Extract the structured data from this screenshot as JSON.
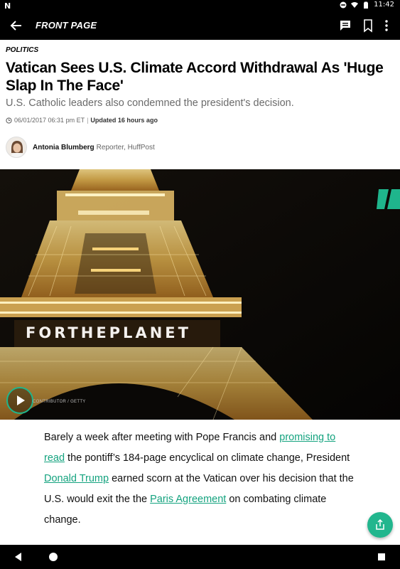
{
  "status_bar": {
    "left_icon": "notification-n-icon",
    "time": "11:42",
    "icons": [
      "do-not-disturb-icon",
      "wifi-icon",
      "battery-icon"
    ]
  },
  "app_bar": {
    "title": "FRONT PAGE",
    "icons": [
      "back-arrow-icon",
      "comments-icon",
      "bookmark-icon",
      "more-vert-icon"
    ]
  },
  "article": {
    "section": "POLITICS",
    "headline": "Vatican Sees U.S. Climate Accord Withdrawal As 'Huge Slap In The Face'",
    "subhead": "U.S. Catholic leaders also condemned the president's decision.",
    "timestamp": "06/01/2017 06:31 pm ET",
    "separator": "|",
    "updated": "Updated 16 hours ago",
    "author_name": "Antonia Blumberg",
    "author_role": "Reporter, HuffPost",
    "image_overlay_text": "FORTHEPLANET",
    "image_credit": "CONTRIBUTOR / GETTY",
    "body": {
      "t1": "Barely a week after meeting with Pope Francis and ",
      "link1": "promising to read",
      "t2": " the pontiff’s 184-page encyclical on climate change, President ",
      "link2": "Donald Trump",
      "t3": " earned scorn at the Vatican over his decision that the U.S. would exit the the ",
      "link3": "Paris Agreement",
      "t4": " on combating climate change."
    }
  },
  "colors": {
    "accent": "#22b68e",
    "link": "#14a37f",
    "bar": "#000000"
  },
  "fab_icon": "share-icon",
  "nav_bar": {
    "icons": [
      "nav-back-icon",
      "nav-home-icon",
      "nav-recents-icon"
    ]
  }
}
